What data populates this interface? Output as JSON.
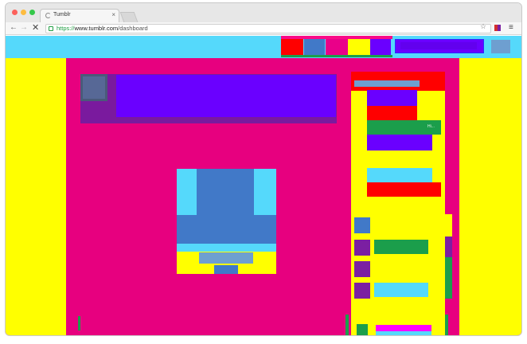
{
  "browser": {
    "tab_title": "Tumblr",
    "tab_close": "×",
    "url_scheme": "https://",
    "url_host": "www.tumblr.com",
    "url_path": "/dashboard",
    "icons": {
      "back": "←",
      "forward": "→",
      "stop": "✕",
      "star": "☆",
      "menu": "≡"
    }
  },
  "page": {
    "right_column": {
      "highlight_text": "Hi..."
    }
  },
  "colors": {
    "magenta": "#e7007f",
    "yellow": "#ffff00",
    "cyan": "#55d9fb",
    "blue": "#4179c8",
    "purple": "#6a00ff",
    "red": "#ff0000",
    "green": "#1b9e4b"
  }
}
